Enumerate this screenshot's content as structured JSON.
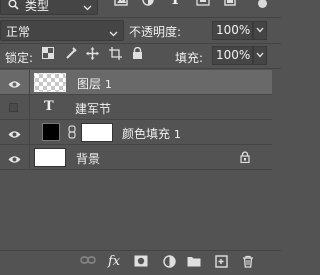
{
  "filter": {
    "kind_label": "类型",
    "icons": [
      "image-filter-icon",
      "adjustment-filter-icon",
      "type-filter-icon",
      "shape-filter-icon",
      "smart-object-filter-icon"
    ]
  },
  "blend": {
    "mode": "正常",
    "opacity_label": "不透明度:",
    "opacity_value": "100%"
  },
  "lock": {
    "label": "锁定:",
    "fill_label": "填充:",
    "fill_value": "100%"
  },
  "layers": [
    {
      "name": "图层",
      "index": "1",
      "kind": "pixel",
      "visible": true,
      "selected": true
    },
    {
      "name": "建军节",
      "kind": "text",
      "visible": false,
      "selected": false
    },
    {
      "name": "颜色填充",
      "index": "1",
      "kind": "fill",
      "visible": true,
      "selected": false
    },
    {
      "name": "背景",
      "kind": "background",
      "visible": true,
      "selected": false,
      "locked": true
    }
  ],
  "toolbar": {
    "fx_label": "fx"
  },
  "colors": {
    "panel_bg": "#535353",
    "selected_row": "#696969",
    "text": "#f0f0f0"
  }
}
